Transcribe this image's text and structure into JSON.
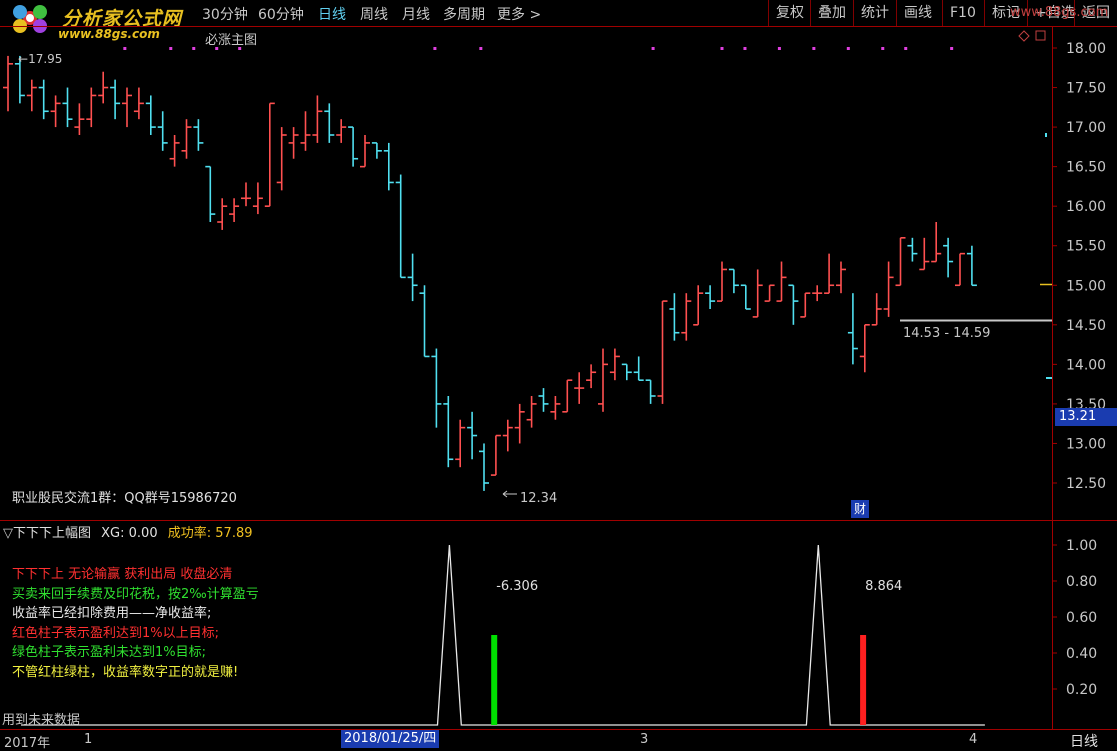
{
  "logo": {
    "name": "分析家公式网",
    "url": "www.88gs.com"
  },
  "periods": [
    {
      "label": "30分钟",
      "active": false
    },
    {
      "label": "60分钟",
      "active": false
    },
    {
      "label": "日线",
      "active": true
    },
    {
      "label": "周线",
      "active": false
    },
    {
      "label": "月线",
      "active": false
    },
    {
      "label": "多周期",
      "active": false
    },
    {
      "label": "更多 >",
      "active": false
    }
  ],
  "toolbar": [
    "复权",
    "叠加",
    "统计",
    "画线",
    "F10",
    "标记",
    "+自选",
    "返回"
  ],
  "main_chart": {
    "title": "必涨主图",
    "high_label": "17.95",
    "low_label": "12.34",
    "range_label": "14.53 - 14.59",
    "qq_text": "职业股民交流1群：QQ群号15986720",
    "finance_badge": "财",
    "price_tag": "13.21",
    "colors": {
      "up": "#ff5050",
      "down": "#50e0f0"
    }
  },
  "chart_data": [
    {
      "type": "candlestick",
      "title": "必涨主图",
      "ylim": [
        12.25,
        18.15
      ],
      "yticks": [
        18.0,
        17.5,
        17.0,
        16.5,
        16.0,
        15.5,
        15.0,
        14.5,
        14.0,
        13.5,
        13.0,
        12.5
      ],
      "ohlc": [
        [
          17.5,
          17.9,
          17.2,
          17.8
        ],
        [
          17.8,
          17.9,
          17.3,
          17.4
        ],
        [
          17.4,
          17.6,
          17.2,
          17.5
        ],
        [
          17.5,
          17.6,
          17.1,
          17.2
        ],
        [
          17.2,
          17.4,
          17.0,
          17.3
        ],
        [
          17.3,
          17.5,
          17.0,
          17.1
        ],
        [
          17.0,
          17.3,
          16.9,
          17.1
        ],
        [
          17.1,
          17.5,
          17.0,
          17.4
        ],
        [
          17.4,
          17.7,
          17.3,
          17.5
        ],
        [
          17.5,
          17.6,
          17.1,
          17.3
        ],
        [
          17.3,
          17.5,
          17.0,
          17.4
        ],
        [
          17.2,
          17.5,
          17.1,
          17.3
        ],
        [
          17.3,
          17.4,
          16.9,
          17.0
        ],
        [
          17.0,
          17.2,
          16.7,
          16.8
        ],
        [
          16.6,
          16.9,
          16.5,
          16.8
        ],
        [
          16.7,
          17.1,
          16.6,
          17.0
        ],
        [
          17.0,
          17.1,
          16.7,
          16.8
        ],
        [
          16.5,
          16.5,
          15.8,
          15.9
        ],
        [
          15.8,
          16.1,
          15.7,
          16.0
        ],
        [
          15.9,
          16.1,
          15.8,
          16.0
        ],
        [
          16.1,
          16.3,
          16.0,
          16.1
        ],
        [
          16.0,
          16.3,
          15.9,
          16.1
        ],
        [
          16.0,
          17.3,
          16.0,
          17.3
        ],
        [
          16.3,
          17.0,
          16.2,
          16.9
        ],
        [
          16.8,
          17.0,
          16.6,
          16.9
        ],
        [
          16.8,
          17.2,
          16.7,
          16.9
        ],
        [
          16.9,
          17.4,
          16.8,
          17.2
        ],
        [
          17.2,
          17.3,
          16.8,
          16.9
        ],
        [
          16.9,
          17.1,
          16.8,
          17.0
        ],
        [
          17.0,
          17.0,
          16.5,
          16.6
        ],
        [
          16.5,
          16.9,
          16.5,
          16.8
        ],
        [
          16.8,
          16.8,
          16.6,
          16.7
        ],
        [
          16.7,
          16.8,
          16.2,
          16.3
        ],
        [
          16.3,
          16.4,
          15.1,
          15.1
        ],
        [
          15.1,
          15.4,
          14.8,
          15.0
        ],
        [
          14.9,
          15.0,
          14.1,
          14.1
        ],
        [
          14.1,
          14.2,
          13.2,
          13.5
        ],
        [
          13.5,
          13.6,
          12.7,
          12.8
        ],
        [
          12.8,
          13.3,
          12.7,
          13.2
        ],
        [
          13.2,
          13.4,
          12.8,
          13.1
        ],
        [
          12.9,
          13.0,
          12.4,
          12.5
        ],
        [
          12.6,
          13.1,
          12.6,
          13.1
        ],
        [
          13.1,
          13.3,
          12.9,
          13.2
        ],
        [
          13.2,
          13.5,
          13.0,
          13.4
        ],
        [
          13.3,
          13.6,
          13.2,
          13.5
        ],
        [
          13.6,
          13.7,
          13.4,
          13.5
        ],
        [
          13.4,
          13.6,
          13.3,
          13.5
        ],
        [
          13.4,
          13.8,
          13.4,
          13.8
        ],
        [
          13.7,
          13.9,
          13.5,
          13.7
        ],
        [
          13.8,
          14.0,
          13.7,
          13.9
        ],
        [
          13.5,
          14.2,
          13.4,
          14.0
        ],
        [
          13.9,
          14.2,
          13.8,
          14.1
        ],
        [
          14.0,
          14.0,
          13.8,
          13.9
        ],
        [
          13.9,
          14.1,
          13.8,
          13.8
        ],
        [
          13.8,
          13.8,
          13.5,
          13.6
        ],
        [
          13.6,
          14.8,
          13.5,
          14.8
        ],
        [
          14.7,
          14.9,
          14.3,
          14.4
        ],
        [
          14.4,
          14.9,
          14.3,
          14.8
        ],
        [
          14.5,
          15.0,
          14.5,
          14.9
        ],
        [
          14.9,
          15.0,
          14.7,
          14.8
        ],
        [
          14.8,
          15.3,
          14.8,
          15.2
        ],
        [
          15.2,
          15.2,
          14.9,
          15.0
        ],
        [
          15.0,
          15.0,
          14.7,
          14.7
        ],
        [
          14.6,
          15.2,
          14.6,
          15.0
        ],
        [
          14.8,
          15.0,
          14.8,
          15.0
        ],
        [
          14.8,
          15.3,
          14.8,
          15.1
        ],
        [
          15.0,
          15.0,
          14.5,
          14.8
        ],
        [
          14.6,
          14.9,
          14.6,
          14.9
        ],
        [
          14.9,
          15.0,
          14.8,
          14.9
        ],
        [
          14.9,
          15.4,
          14.9,
          15.0
        ],
        [
          15.0,
          15.3,
          14.9,
          15.2
        ],
        [
          14.4,
          14.9,
          14.0,
          14.2
        ],
        [
          14.1,
          14.5,
          13.9,
          14.5
        ],
        [
          14.5,
          14.9,
          14.5,
          14.7
        ],
        [
          14.7,
          15.3,
          14.6,
          15.1
        ],
        [
          15.0,
          15.6,
          15.0,
          15.6
        ],
        [
          15.5,
          15.6,
          15.3,
          15.4
        ],
        [
          15.2,
          15.6,
          15.2,
          15.3
        ],
        [
          15.3,
          15.8,
          15.3,
          15.4
        ],
        [
          15.5,
          15.6,
          15.1,
          15.3
        ],
        [
          15.0,
          15.4,
          15.0,
          15.4
        ],
        [
          15.4,
          15.5,
          15.0,
          15.0
        ]
      ]
    },
    {
      "type": "line",
      "title": "下下下上幅图",
      "ylim": [
        0.0,
        1.05
      ],
      "yticks": [
        1.0,
        0.8,
        0.6,
        0.4,
        0.2
      ],
      "series": [
        {
          "name": "XG",
          "values": [
            0,
            0,
            0,
            0,
            0,
            0,
            0,
            0,
            0,
            0,
            0,
            0,
            0,
            0,
            0,
            0,
            0,
            0,
            0,
            0,
            0,
            0,
            0,
            0,
            0,
            0,
            0,
            0,
            0,
            0,
            0,
            0,
            0,
            0,
            0,
            0,
            1,
            0,
            0,
            0,
            0,
            0,
            0,
            0,
            0,
            0,
            0,
            0,
            0,
            0,
            0,
            0,
            0,
            0,
            0,
            0,
            0,
            0,
            0,
            0,
            0,
            0,
            0,
            0,
            0,
            0,
            0,
            1,
            0,
            0,
            0,
            0,
            0,
            0,
            0,
            0,
            0,
            0,
            0,
            0,
            0,
            0
          ]
        }
      ],
      "bars": [
        {
          "index": 38,
          "value": 0.5,
          "color": "#00e000",
          "label": "-6.306"
        },
        {
          "index": 69,
          "value": 0.5,
          "color": "#ff2020",
          "label": "8.864"
        }
      ]
    }
  ],
  "indicator": {
    "name": "下下下上幅图",
    "xg_label": "XG:",
    "xg_value": "0.00",
    "rate_label": "成功率:",
    "rate_value": "57.89",
    "lines": [
      {
        "text": "下下下上 无论输赢 获利出局 收盘必清",
        "color": "#ff3030"
      },
      {
        "text": "买卖来回手续费及印花税，按2‰计算盈亏",
        "color": "#30e030"
      },
      {
        "text": "收益率已经扣除费用——净收益率;",
        "color": "#e8e8e8"
      },
      {
        "text": "红色柱子表示盈利达到1%以上目标;",
        "color": "#ff3030"
      },
      {
        "text": "绿色柱子表示盈利未达到1%目标;",
        "color": "#30e030"
      },
      {
        "text": "不管红柱绿柱，收益率数字正的就是赚!",
        "color": "#f0f040"
      }
    ],
    "future_text": "用到未来数据"
  },
  "dates": {
    "year": "2017年",
    "m1": "1",
    "active": "2018/01/25/四",
    "m3": "3",
    "m4": "4"
  },
  "right_bottom": "日线",
  "watermark": "www.88gs.com"
}
